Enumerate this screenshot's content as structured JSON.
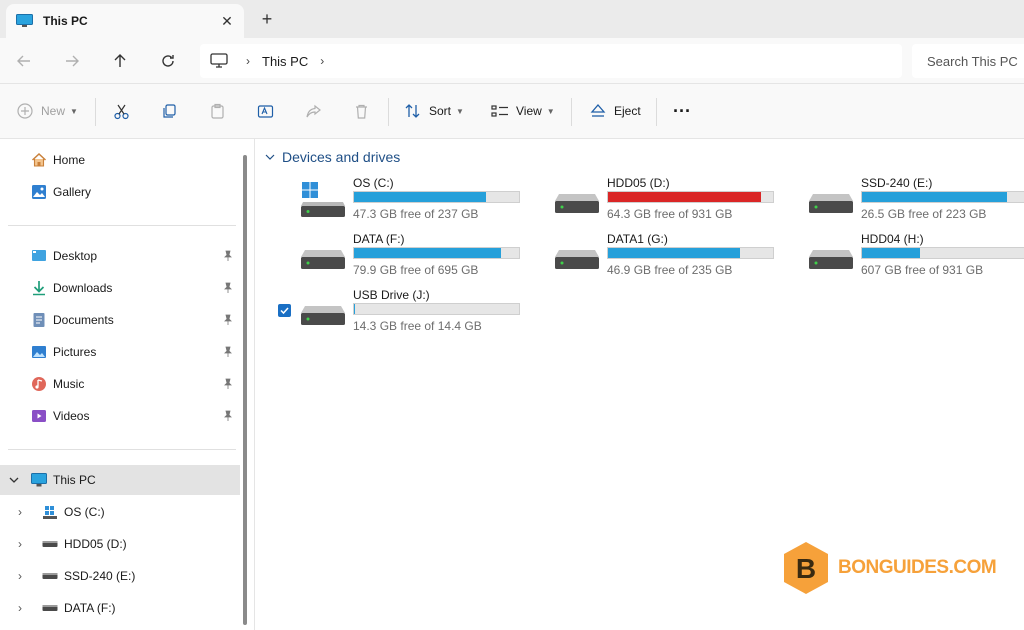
{
  "tab": {
    "title": "This PC",
    "close": "✕",
    "new_tab": "+"
  },
  "address": {
    "crumb": "This PC",
    "search_placeholder": "Search This PC"
  },
  "commands": {
    "new": "New",
    "sort": "Sort",
    "view": "View",
    "eject": "Eject",
    "more": "···"
  },
  "sidebar": {
    "quick": [
      {
        "label": "Home",
        "icon": "home-icon"
      },
      {
        "label": "Gallery",
        "icon": "gallery-icon"
      }
    ],
    "pinned": [
      {
        "label": "Desktop",
        "icon": "desktop-icon"
      },
      {
        "label": "Downloads",
        "icon": "downloads-icon"
      },
      {
        "label": "Documents",
        "icon": "documents-icon"
      },
      {
        "label": "Pictures",
        "icon": "pictures-icon"
      },
      {
        "label": "Music",
        "icon": "music-icon"
      },
      {
        "label": "Videos",
        "icon": "videos-icon"
      }
    ],
    "thispc": {
      "label": "This PC",
      "icon": "computer-icon"
    },
    "drives": [
      {
        "label": "OS (C:)",
        "icon": "windows-drive-icon"
      },
      {
        "label": "HDD05 (D:)",
        "icon": "drive-icon"
      },
      {
        "label": "SSD-240 (E:)",
        "icon": "drive-icon"
      },
      {
        "label": "DATA (F:)",
        "icon": "drive-icon"
      }
    ]
  },
  "content": {
    "group_title": "Devices and drives",
    "drives": [
      {
        "name": "OS (C:)",
        "free": "47.3 GB free of 237 GB",
        "used_fraction": 0.8,
        "color": "#26a0da",
        "os": true
      },
      {
        "name": "HDD05 (D:)",
        "free": "64.3 GB free of 931 GB",
        "used_fraction": 0.93,
        "color": "#da2626",
        "os": false
      },
      {
        "name": "SSD-240 (E:)",
        "free": "26.5 GB free of 223 GB",
        "used_fraction": 0.88,
        "color": "#26a0da",
        "os": false
      },
      {
        "name": "DATA (F:)",
        "free": "79.9 GB free of 695 GB",
        "used_fraction": 0.89,
        "color": "#26a0da",
        "os": false
      },
      {
        "name": "DATA1 (G:)",
        "free": "46.9 GB free of 235 GB",
        "used_fraction": 0.8,
        "color": "#26a0da",
        "os": false
      },
      {
        "name": "HDD04 (H:)",
        "free": "607 GB free of 931 GB",
        "used_fraction": 0.35,
        "color": "#26a0da",
        "os": false
      },
      {
        "name": "USB Drive (J:)",
        "free": "14.3 GB free of 14.4 GB",
        "used_fraction": 0.007,
        "color": "#26a0da",
        "os": false
      }
    ]
  },
  "watermark": {
    "text": "BONGUIDES.COM",
    "letter": "B"
  }
}
